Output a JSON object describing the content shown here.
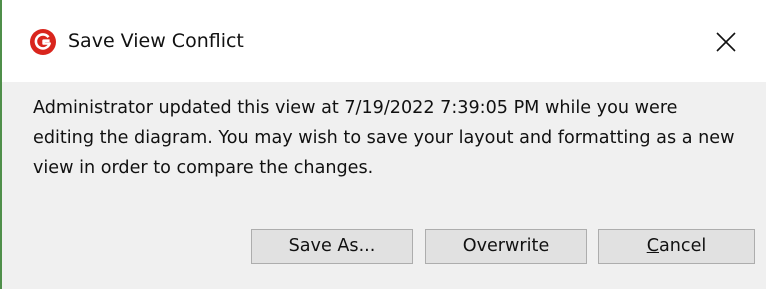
{
  "window": {
    "title": "Save View Conflict",
    "icon": "app-logo-icon",
    "close_icon": "close-icon"
  },
  "message": {
    "text": "Administrator updated this view at 7/19/2022 7:39:05 PM while you were editing the diagram. You may wish to save your layout and formatting as a new view in order to compare the changes."
  },
  "buttons": {
    "save_as": "Save As...",
    "overwrite": "Overwrite",
    "cancel": "Cancel"
  },
  "colors": {
    "frame_accent": "#4f8f4a",
    "icon_red": "#d9251d",
    "body_background": "#f0f0f0",
    "button_background": "#e1e1e1"
  }
}
